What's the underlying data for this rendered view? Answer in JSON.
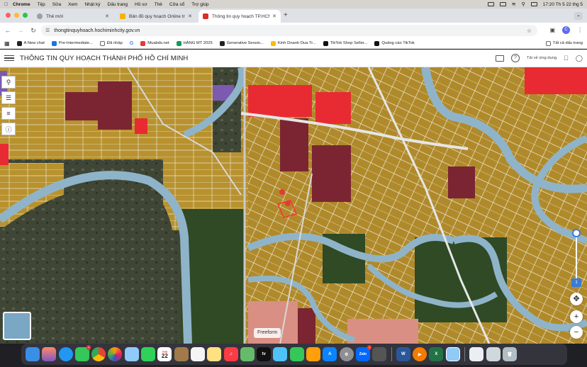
{
  "menubar": {
    "app": "Chrome",
    "items": [
      "Tệp",
      "Sửa",
      "Xem",
      "Nhật ký",
      "Dấu trang",
      "Hồ sơ",
      "Thẻ",
      "Cửa sổ",
      "Trợ giúp"
    ],
    "datetime": "17:20 Th 5 22 thg 5"
  },
  "tabs": [
    {
      "title": "Thẻ mới",
      "favicon_color": "#5f6368",
      "active": false
    },
    {
      "title": "Bản đồ quy hoạch Online trực tu",
      "favicon_color": "#f4b400",
      "active": false
    },
    {
      "title": "Thông tin quy hoạch TP.HCM",
      "favicon_color": "#d93025",
      "active": true
    }
  ],
  "address": {
    "url": "thongtinquyhoach.hochiminhcity.gov.vn",
    "avatar_letter": "C"
  },
  "bookmarks": {
    "items": [
      {
        "label": "A New chat",
        "icon_color": "#222"
      },
      {
        "label": "Pre-Intermediate...",
        "icon_color": "#1a73e8"
      },
      {
        "label": "Đã nhập",
        "icon_color": "#666"
      },
      {
        "label": "",
        "icon_color": "#4285f4"
      },
      {
        "label": "Muabds.net",
        "icon_color": "#e53935"
      },
      {
        "label": "HÀNG MT 2025",
        "icon_color": "#0f9d58"
      },
      {
        "label": "Generative Sessio...",
        "icon_color": "#222"
      },
      {
        "label": "Kinh Doanh Dua Tr...",
        "icon_color": "#fbbc05"
      },
      {
        "label": "TikTok Shop Seller...",
        "icon_color": "#111"
      },
      {
        "label": "Quảng cáo TikTok",
        "icon_color": "#111"
      }
    ],
    "all_bookmarks": "Tất cả dấu trang"
  },
  "site": {
    "title": "THÔNG TIN QUY HOẠCH THÀNH PHỐ HỒ CHÍ MINH",
    "download_app": "Tải về ứng dụng"
  },
  "map": {
    "freeform_label": "Freeform",
    "zoom_in": "+",
    "zoom_out": "−",
    "zoom_marker": "1",
    "colors": {
      "residential": "#b8922e",
      "water": "#8fb4c9",
      "commercial": "#e82b32",
      "dark_red": "#7b2532",
      "green": "#2f4a25",
      "pink": "#d98f83",
      "purple": "#7b5ab0"
    }
  },
  "dock": {
    "calendar_day": "22",
    "calendar_month": "TH5",
    "zalo_label": "Zalo",
    "apps": [
      "finder",
      "launchpad",
      "safari",
      "messages",
      "chrome",
      "photos",
      "preview",
      "facetime",
      "calendar",
      "notes-brown",
      "reminders",
      "notes",
      "music",
      "maps",
      "appletv",
      "files",
      "numbers",
      "pages",
      "appstore",
      "settings",
      "zalo",
      "phone",
      "word",
      "keynote",
      "excel",
      "preview2",
      "file",
      "table",
      "trash"
    ]
  }
}
